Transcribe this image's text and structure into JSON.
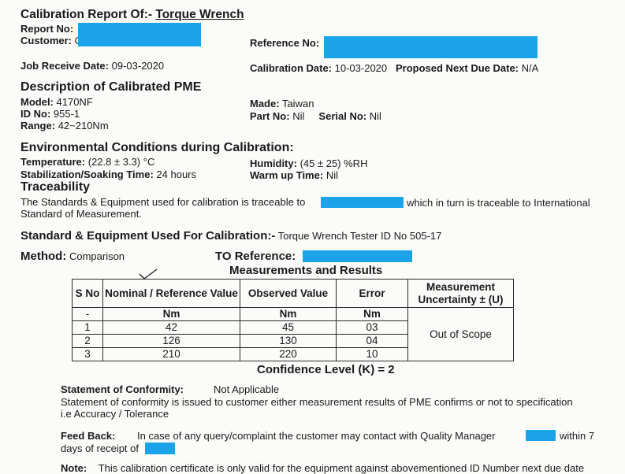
{
  "report": {
    "title_prefix": "Calibration Report Of:-",
    "title_item": "Torque Wrench",
    "report_no_label": "Report No:",
    "customer_label": "Customer:",
    "customer_initial": "C",
    "reference_label": "Reference No:",
    "job_receive_label": "Job Receive Date:",
    "job_receive_value": "09-03-2020",
    "calibration_date_label": "Calibration Date:",
    "calibration_date_value": "10-03-2020",
    "next_due_label": "Proposed Next Due Date:",
    "next_due_value": "N/A"
  },
  "pme": {
    "heading": "Description of Calibrated PME",
    "model_label": "Model:",
    "model_value": "4170NF",
    "id_label": "ID No:",
    "id_value": "955-1",
    "range_label": "Range:",
    "range_value": "42~210Nm",
    "made_label": "Made:",
    "made_value": "Taiwan",
    "part_label": "Part No:",
    "part_value": "Nil",
    "serial_label": "Serial No:",
    "serial_value": "Nil"
  },
  "environment": {
    "heading": "Environmental Conditions during Calibration:",
    "temp_label": "Temperature:",
    "temp_value": "(22.8 ± 3.3) °C",
    "humidity_label": "Humidity:",
    "humidity_value": "(45 ± 25) %RH",
    "soak_label": "Stabilization/Soaking Time:",
    "soak_value": "24 hours",
    "warmup_label": "Warm up Time:",
    "warmup_value": "Nil"
  },
  "traceability": {
    "heading": "Traceability",
    "line1_a": "The Standards & Equipment used for calibration is traceable to",
    "line1_b": "which in turn is traceable to International",
    "line2": "Standard of Measurement."
  },
  "standard": {
    "label": "Standard & Equipment Used For Calibration:-",
    "value": "Torque Wrench Tester ID No 505-17"
  },
  "method": {
    "label": "Method:",
    "value": "Comparison",
    "to_label": "TO Reference:"
  },
  "measurements": {
    "heading": "Measurements and Results",
    "col_sno": "S No",
    "col_nominal": "Nominal / Reference Value",
    "col_observed": "Observed Value",
    "col_error": "Error",
    "col_uncertainty": "Measurement Uncertainty ± (U)",
    "unit_row": [
      "-",
      "Nm",
      "Nm",
      "Nm"
    ],
    "rows": [
      [
        "1",
        "42",
        "45",
        "03"
      ],
      [
        "2",
        "126",
        "130",
        "04"
      ],
      [
        "3",
        "210",
        "220",
        "10"
      ]
    ],
    "uncertainty_value": "Out of Scope",
    "confidence": "Confidence Level (K) = 2"
  },
  "conformity": {
    "label": "Statement of Conformity:",
    "value": "Not Applicable",
    "line1": "Statement of conformity is issued to customer either measurement results of PME confirms or not to specification",
    "line2": "i.e Accuracy / Tolerance"
  },
  "feedback": {
    "label": "Feed Back:",
    "text_a": "In case of any query/complaint the customer may contact with Quality Manager",
    "text_b": "within 7",
    "text_c": "days of receipt of"
  },
  "note": {
    "label": "Note:",
    "text": "This calibration certificate is only valid for the equipment against abovementioned ID Number next due date"
  },
  "colors": {
    "redaction": "#1aa3e8"
  }
}
